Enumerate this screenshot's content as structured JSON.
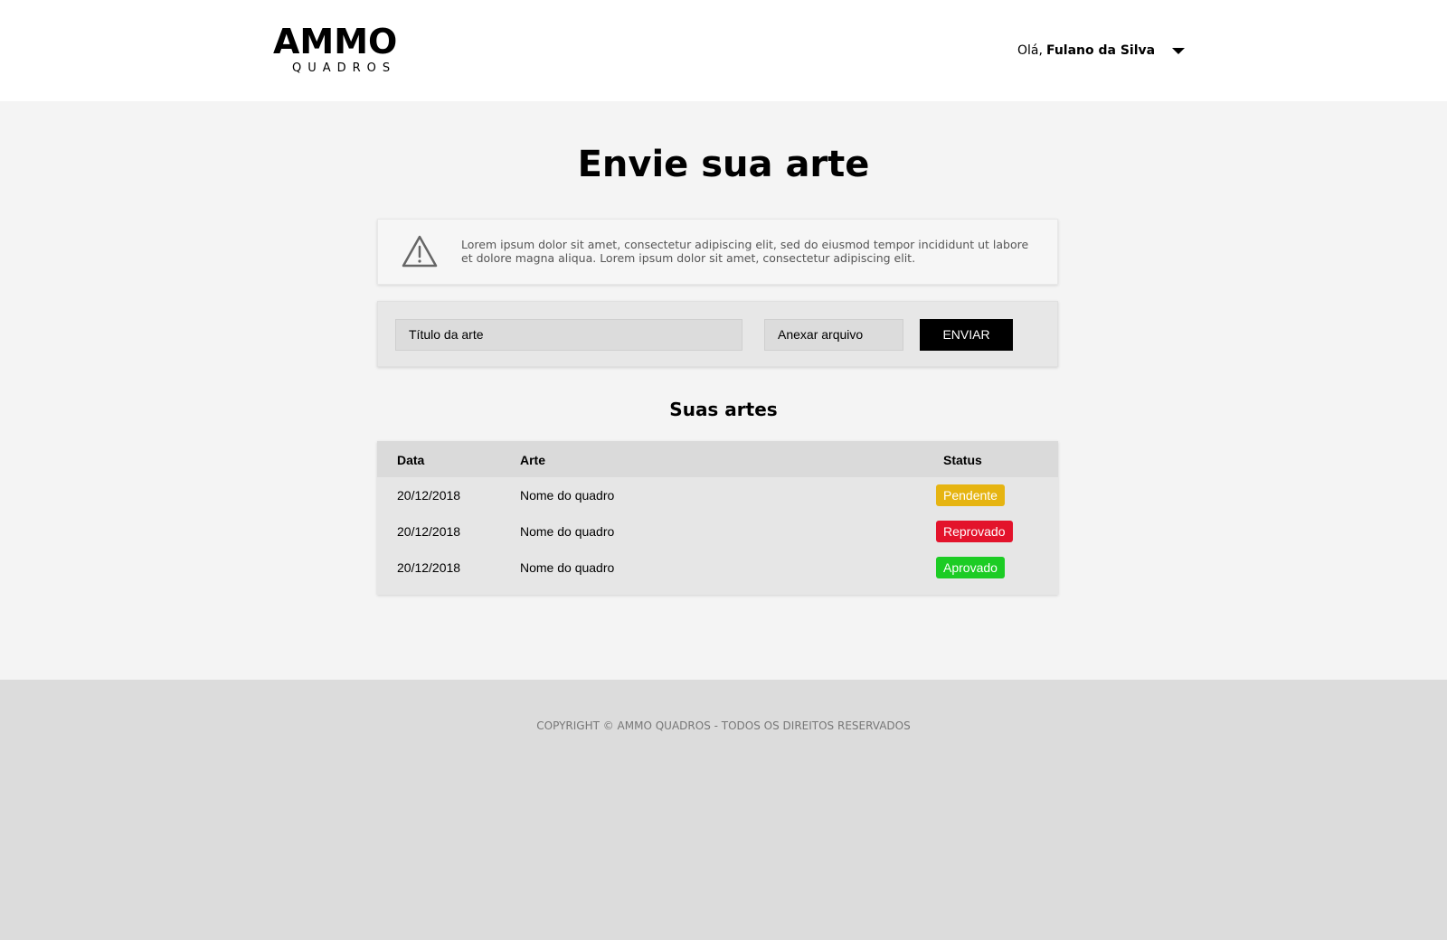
{
  "header": {
    "logo_top": "AMMO",
    "logo_bottom": "QUADROS",
    "greeting": "Olá,",
    "user_name": "Fulano da Silva"
  },
  "main": {
    "title": "Envie sua arte",
    "alert_text": "Lorem ipsum dolor sit amet, consectetur adipiscing elit, sed do eiusmod tempor incididunt ut labore et dolore magna aliqua. Lorem ipsum dolor sit amet, consectetur adipiscing elit.",
    "upload": {
      "title_placeholder": "Título da arte",
      "file_label": "Anexar arquivo",
      "send_label": "ENVIAR"
    },
    "arts_title": "Suas artes",
    "table": {
      "headers": [
        "Data",
        "Arte",
        "Status"
      ],
      "rows": [
        {
          "date": "20/12/2018",
          "art": "Nome do quadro",
          "status": "Pendente"
        },
        {
          "date": "20/12/2018",
          "art": "Nome do quadro",
          "status": "Reprovado"
        },
        {
          "date": "20/12/2018",
          "art": "Nome do quadro",
          "status": "Aprovado"
        }
      ]
    }
  },
  "status_colors": {
    "Pendente": "#e6b411",
    "Reprovado": "#e3132b",
    "Aprovado": "#1ccc24"
  },
  "footer": {
    "copyright": "COPYRIGHT © AMMO QUADROS - TODOS OS DIREITOS RESERVADOS"
  }
}
